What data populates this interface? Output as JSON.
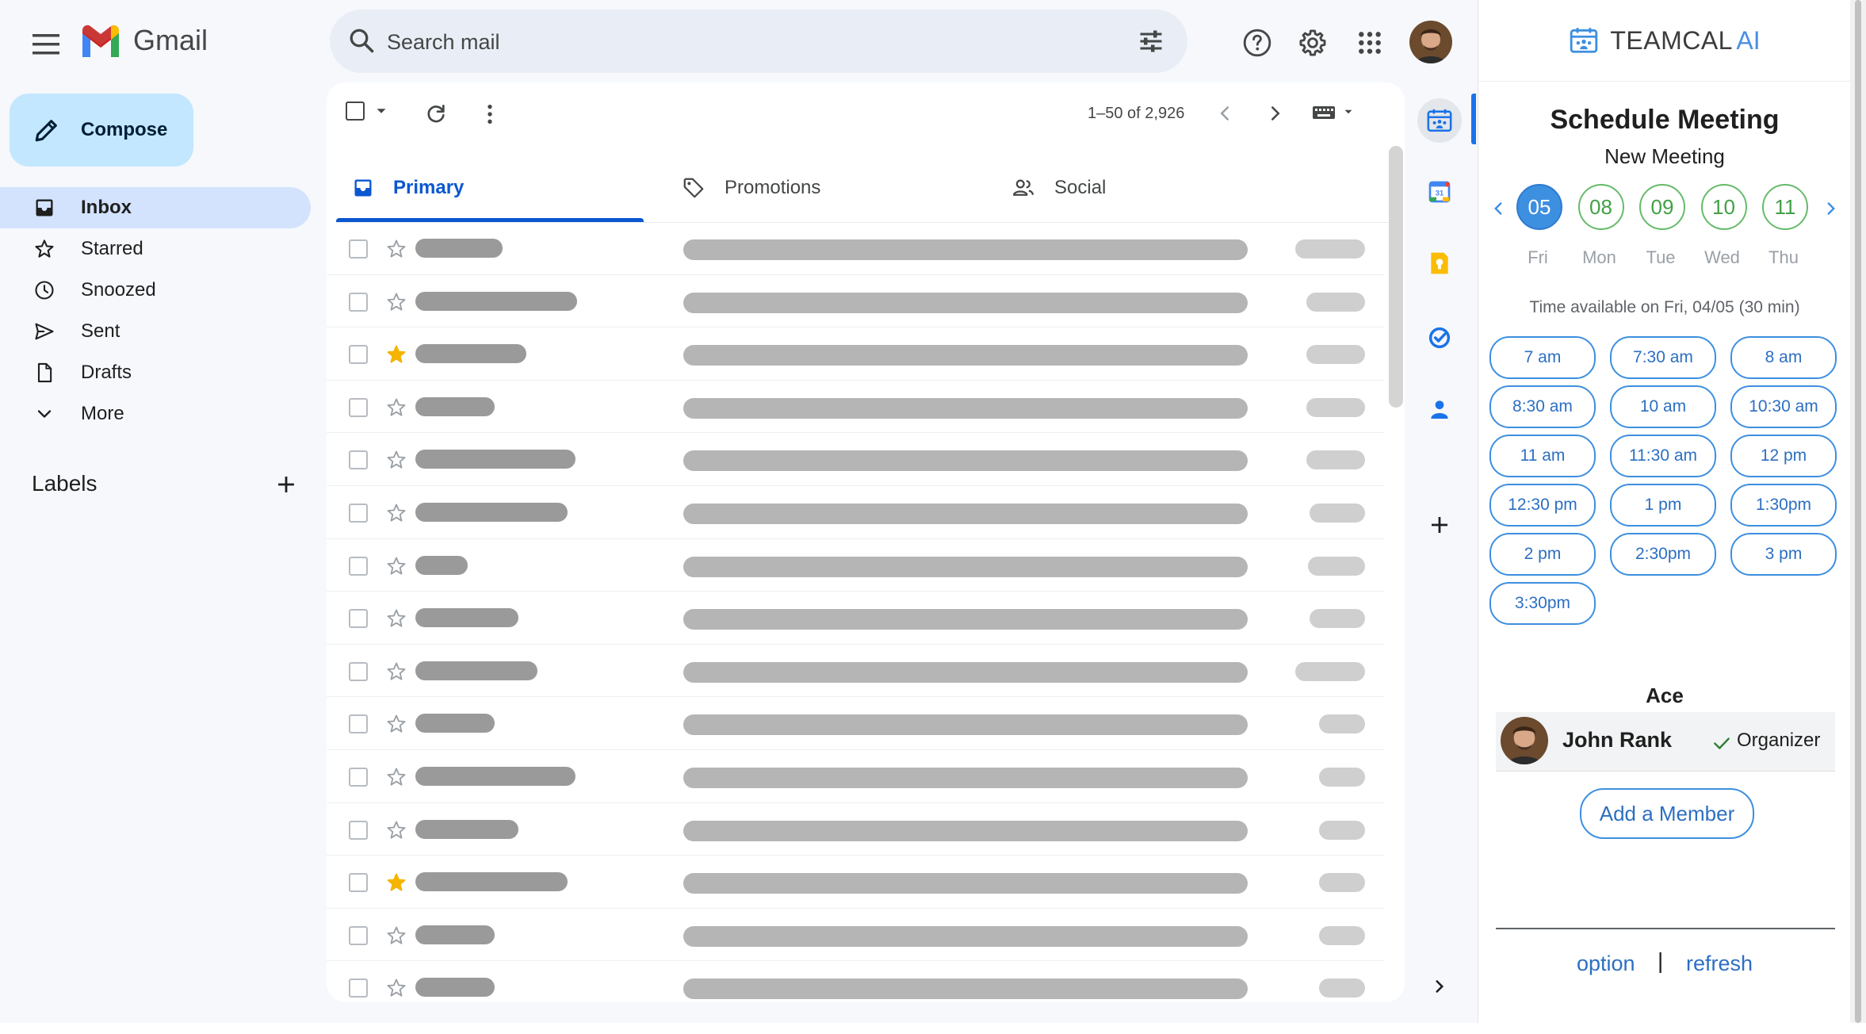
{
  "app": {
    "logo_text": "Gmail"
  },
  "search": {
    "placeholder": "Search mail"
  },
  "compose": {
    "label": "Compose"
  },
  "nav": {
    "items": [
      {
        "label": "Inbox",
        "icon": "inbox-icon",
        "active": true
      },
      {
        "label": "Starred",
        "icon": "star-icon"
      },
      {
        "label": "Snoozed",
        "icon": "clock-icon"
      },
      {
        "label": "Sent",
        "icon": "send-icon"
      },
      {
        "label": "Drafts",
        "icon": "draft-icon"
      },
      {
        "label": "More",
        "icon": "chevron-down-icon"
      }
    ]
  },
  "labels": {
    "title": "Labels"
  },
  "toolbar": {
    "pager": "1–50 of 2,926"
  },
  "tabs": [
    {
      "label": "Primary",
      "icon": "inbox-icon",
      "active": true
    },
    {
      "label": "Promotions",
      "icon": "tag-icon"
    },
    {
      "label": "Social",
      "icon": "people-icon"
    }
  ],
  "mail_rows": [
    {
      "starred": false
    },
    {
      "starred": false
    },
    {
      "starred": true
    },
    {
      "starred": false
    },
    {
      "starred": false
    },
    {
      "starred": false
    },
    {
      "starred": false
    },
    {
      "starred": false
    },
    {
      "starred": false
    },
    {
      "starred": false
    },
    {
      "starred": false
    },
    {
      "starred": false
    },
    {
      "starred": true
    },
    {
      "starred": false
    },
    {
      "starred": false
    }
  ],
  "teamcal": {
    "brand": "TEAMCAL",
    "brand_ai": "AI",
    "title": "Schedule Meeting",
    "subtitle": "New Meeting",
    "dates": [
      {
        "num": "05",
        "day": "Fri",
        "selected": true
      },
      {
        "num": "08",
        "day": "Mon"
      },
      {
        "num": "09",
        "day": "Tue"
      },
      {
        "num": "10",
        "day": "Wed"
      },
      {
        "num": "11",
        "day": "Thu"
      }
    ],
    "availability": "Time available on Fri, 04/05 (30 min)",
    "slots": [
      "7 am",
      "7:30 am",
      "8 am",
      "8:30 am",
      "10 am",
      "10:30 am",
      "11 am",
      "11:30 am",
      "12 pm",
      "12:30 pm",
      "1 pm",
      "1:30pm",
      "2 pm",
      "2:30pm",
      "3 pm",
      "3:30pm"
    ],
    "team_name": "Ace",
    "member": {
      "name": "John Rank",
      "role": "Organizer"
    },
    "add_member": "Add a Member",
    "footer": {
      "option": "option",
      "separator": "|",
      "refresh": "refresh"
    }
  },
  "colors": {
    "accent_blue": "#0b57d0",
    "teamcal_blue": "#3d8fe0",
    "date_green": "#43a047",
    "star_yellow": "#f4b400",
    "compose_bg": "#c2e7ff",
    "active_nav_bg": "#d3e3fd"
  }
}
